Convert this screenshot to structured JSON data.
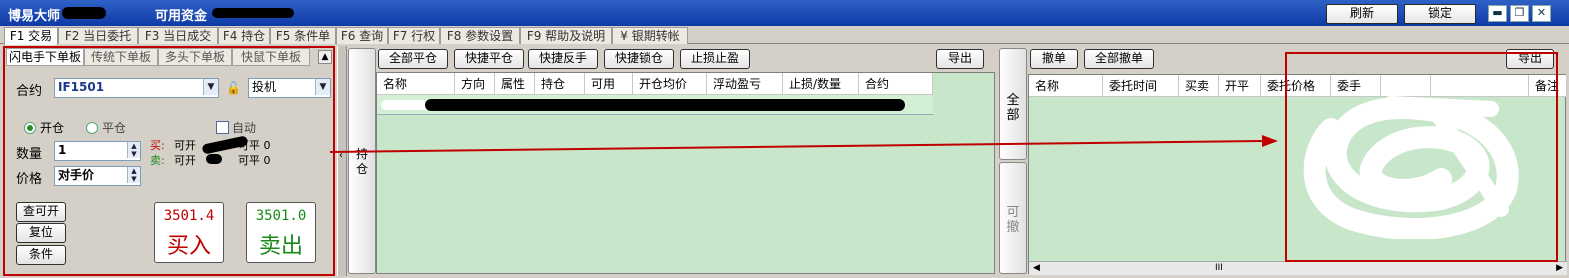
{
  "title": {
    "app_name": "博易大师",
    "funds_label": "可用资金",
    "refresh": "刷新",
    "lock": "锁定",
    "win_min": "▬",
    "win_restore": "❐",
    "win_close": "✕"
  },
  "tabs": [
    "F1 交易",
    "F2 当日委托",
    "F3 当日成交",
    "F4 持仓",
    "F5 条件单",
    "F6 查询",
    "F7 行权",
    "F8 参数设置",
    "F9 帮助及说明",
    "¥ 银期转帐"
  ],
  "order_panel": {
    "subtabs": [
      "闪电手下单板",
      "传统下单板",
      "多头下单板",
      "快鼠下单板"
    ],
    "contract_label": "合约",
    "contract_value": "IF1501",
    "hedge_value": "投机",
    "open_label": "开仓",
    "close_label": "平仓",
    "auto_label": "自动",
    "qty_label": "数量",
    "qty_value": "1",
    "price_label": "价格",
    "price_value": "对手价",
    "buy_info_prefix": "买:",
    "buy_info_text": "可开",
    "buy_close_text": "可平 0",
    "sell_info_prefix": "卖:",
    "sell_info_text": "可开",
    "sell_close_text": "可平 0",
    "query_open": "查可开",
    "reset": "复位",
    "condition": "条件",
    "buy_price": "3501.4",
    "buy_label": "买入",
    "sell_price": "3501.0",
    "sell_label": "卖出"
  },
  "positions": {
    "side_button": "持仓",
    "toolbar": [
      "全部平仓",
      "快捷平仓",
      "快捷反手",
      "快捷锁仓",
      "止损止盈"
    ],
    "export": "导出",
    "columns": [
      "名称",
      "方向",
      "属性",
      "持仓",
      "可用",
      "开仓均价",
      "浮动盈亏",
      "止损/数量",
      "合约"
    ]
  },
  "orders": {
    "side_all": "全部",
    "side_cancelable": "可撤",
    "toolbar": [
      "撤单",
      "全部撤单"
    ],
    "export": "导出",
    "columns": [
      "名称",
      "委托时间",
      "买卖",
      "开平",
      "委托价格",
      "委手",
      "",
      "",
      "备注"
    ],
    "scroll_mark": "III"
  },
  "colors": {
    "title_bg": "#1f4fb8",
    "grid_bg": "#c8e6c9",
    "annotation_red": "#c00000",
    "buy": "#c00000",
    "sell": "#1a8a1a"
  }
}
